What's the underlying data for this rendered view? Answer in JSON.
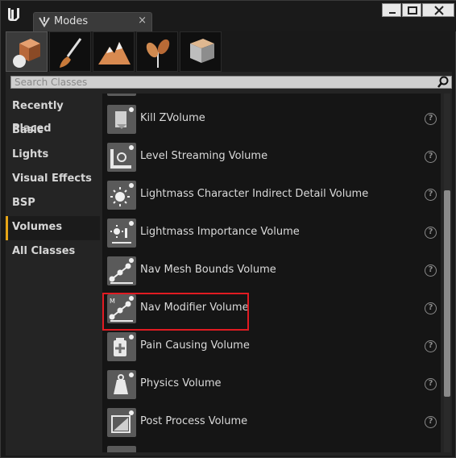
{
  "window": {
    "tab_title": "Modes",
    "tab_close": "×",
    "buttons": [
      "minimize",
      "maximize",
      "close"
    ]
  },
  "modes": [
    {
      "name": "place",
      "icon": "cube-sphere-icon",
      "active": true
    },
    {
      "name": "paint",
      "icon": "paintbrush-icon",
      "active": false
    },
    {
      "name": "landscape",
      "icon": "mountain-icon",
      "active": false
    },
    {
      "name": "foliage",
      "icon": "leaves-icon",
      "active": false
    },
    {
      "name": "geometry",
      "icon": "box-edit-icon",
      "active": false
    }
  ],
  "search": {
    "placeholder": "Search Classes",
    "value": ""
  },
  "categories": [
    {
      "label": "Recently Placed",
      "active": false
    },
    {
      "label": "Basic",
      "active": false
    },
    {
      "label": "Lights",
      "active": false
    },
    {
      "label": "Visual Effects",
      "active": false
    },
    {
      "label": "BSP",
      "active": false
    },
    {
      "label": "Volumes",
      "active": true
    },
    {
      "label": "All Classes",
      "active": false
    }
  ],
  "items": [
    {
      "label": "Kill ZVolume",
      "icon": "kill-z-volume-icon"
    },
    {
      "label": "Level Streaming Volume",
      "icon": "level-streaming-icon"
    },
    {
      "label": "Lightmass Character Indirect Detail Volume",
      "icon": "sun-icon"
    },
    {
      "label": "Lightmass Importance Volume",
      "icon": "lightmass-importance-icon"
    },
    {
      "label": "Nav Mesh Bounds Volume",
      "icon": "nav-mesh-icon"
    },
    {
      "label": "Nav Modifier Volume",
      "icon": "nav-modifier-icon",
      "highlighted": true
    },
    {
      "label": "Pain Causing Volume",
      "icon": "first-aid-icon"
    },
    {
      "label": "Physics Volume",
      "icon": "weight-icon"
    },
    {
      "label": "Post Process Volume",
      "icon": "post-process-icon"
    }
  ],
  "help_glyph": "?",
  "colors": {
    "accent": "#e6a517",
    "highlight_box": "#e11b22"
  }
}
